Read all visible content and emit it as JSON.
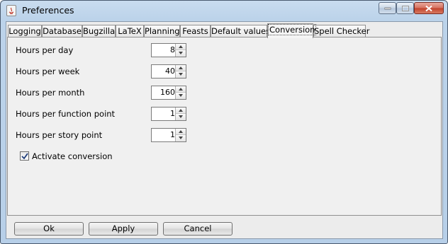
{
  "window": {
    "title": "Preferences"
  },
  "tabs": [
    {
      "label": "Logging"
    },
    {
      "label": "Database"
    },
    {
      "label": "Bugzilla"
    },
    {
      "label": "LaTeX"
    },
    {
      "label": "Planning"
    },
    {
      "label": "Feasts"
    },
    {
      "label": "Default values"
    },
    {
      "label": "Conversion"
    },
    {
      "label": "Spell Checker"
    }
  ],
  "active_tab": "Conversion",
  "conversion": {
    "fields": [
      {
        "label": "Hours per day",
        "value": "8"
      },
      {
        "label": "Hours per week",
        "value": "40"
      },
      {
        "label": "Hours per month",
        "value": "160"
      },
      {
        "label": "Hours per function point",
        "value": "1"
      },
      {
        "label": "Hours per story point",
        "value": "1"
      }
    ],
    "activate": {
      "label": "Activate conversion",
      "checked": true
    }
  },
  "buttons": {
    "ok": "Ok",
    "apply": "Apply",
    "cancel": "Cancel"
  }
}
